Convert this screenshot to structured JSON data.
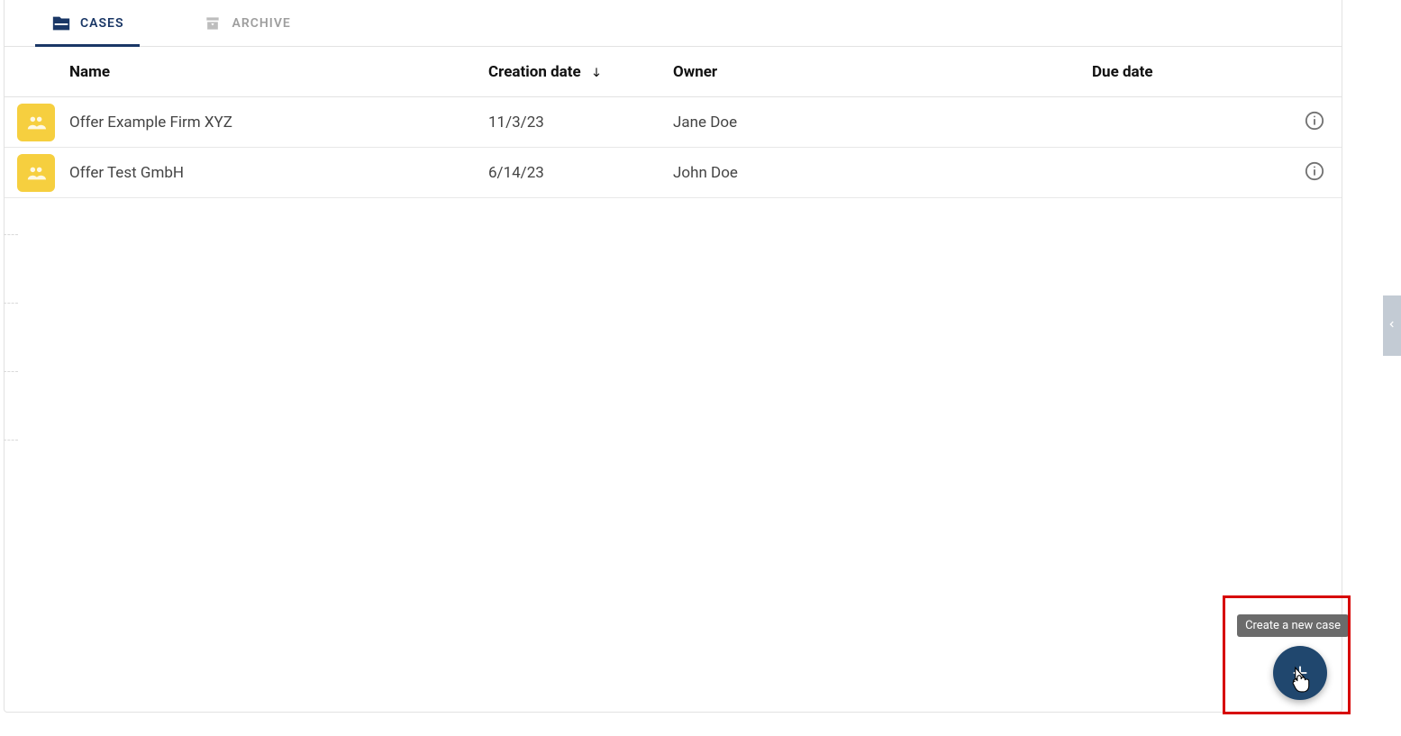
{
  "tabs": {
    "cases": "CASES",
    "archive": "ARCHIVE"
  },
  "columns": {
    "name": "Name",
    "creation_date": "Creation date",
    "owner": "Owner",
    "due_date": "Due date"
  },
  "rows": [
    {
      "name": "Offer Example Firm XYZ",
      "creation_date": "11/3/23",
      "owner": "Jane Doe",
      "due_date": ""
    },
    {
      "name": "Offer Test GmbH",
      "creation_date": "6/14/23",
      "owner": "John Doe",
      "due_date": ""
    }
  ],
  "fab": {
    "tooltip": "Create a new case"
  }
}
